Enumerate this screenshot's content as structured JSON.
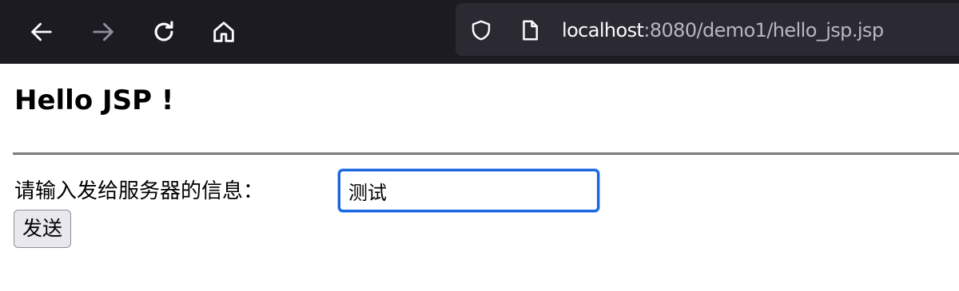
{
  "browser": {
    "nav_buttons": [
      {
        "name": "back-icon",
        "enabled": true
      },
      {
        "name": "forward-icon",
        "enabled": false
      },
      {
        "name": "reload-icon",
        "enabled": true
      },
      {
        "name": "home-icon",
        "enabled": true
      }
    ],
    "url": {
      "host": "localhost",
      "rest": ":8080/demo1/hello_jsp.jsp"
    },
    "url_icons": [
      "shield-icon",
      "page-icon"
    ],
    "colors": {
      "toolbar_bg": "#1c1b22",
      "urlbar_bg": "#2b2a33",
      "icon_active": "#fbfbfe",
      "icon_disabled": "#8f8f9d",
      "url_host": "#fbfbfe",
      "url_rest": "#b8b7c0"
    }
  },
  "page": {
    "heading": "Hello JSP !",
    "prompt_label": "请输入发给服务器的信息：",
    "message_input": {
      "value": "测试"
    },
    "send_button_label": "发送",
    "colors": {
      "input_focus_border": "#1a66e0",
      "button_bg": "#e9e9ed"
    }
  }
}
